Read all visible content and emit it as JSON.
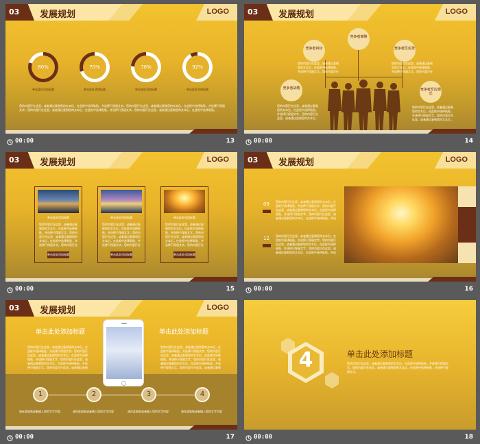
{
  "common": {
    "section_no": "03",
    "section_title": "发展规划",
    "logo": "LOGO",
    "time": "00:00",
    "placeholder_caption": "单击此处添加标题",
    "body_text": "您的内容打在这里，或者通过复制您的文本后，在此框中选择粘贴，并选择只保留文字。您的内容打在这里，或者通过复制您的文本后，在此框中选择粘贴，并选择只保留文字。您的内容打在这里，或者通过复制您的文本后，在此框中选择粘贴，并选择只保留文字。您的内容打在这里，或者通过复制您的文本后，在此框中选择粘贴。"
  },
  "slides": [
    {
      "number": "13",
      "donuts": [
        {
          "label": "80%",
          "value": 80
        },
        {
          "label": "70%",
          "value": 70
        },
        {
          "label": "76%",
          "value": 76
        },
        {
          "label": "92%",
          "value": 92
        }
      ]
    },
    {
      "number": "14",
      "bubbles": [
        "竞争者目标",
        "竞争者策略",
        "竞争者优劣势",
        "竞争者战略",
        "竞争者反应模式"
      ]
    },
    {
      "number": "15",
      "button_label": "单击此处添加标题"
    },
    {
      "number": "16",
      "years": [
        "08",
        "12"
      ]
    },
    {
      "number": "17",
      "heading_left": "单击此处添加标题",
      "heading_right": "单击此处添加标题",
      "steps": [
        "1",
        "2",
        "3",
        "4"
      ],
      "step_caption": "请在此输入标题",
      "step_text": "请在此粘贴或者输入您的文字内容"
    },
    {
      "number": "18",
      "digit": "4",
      "title": "单击此处添加标题",
      "body": "您的内容打在这里，或者通过复制您的文本后，在此框中选择粘贴，并选择只保留文字。您的内容打在这里，或者通过复制您的文本后，在此框中选择粘贴，并选择只保留文字。"
    }
  ],
  "colors": {
    "accent_dark": "#6b2f17",
    "gold": "#f3c32e",
    "cream": "#fbe6a6"
  }
}
